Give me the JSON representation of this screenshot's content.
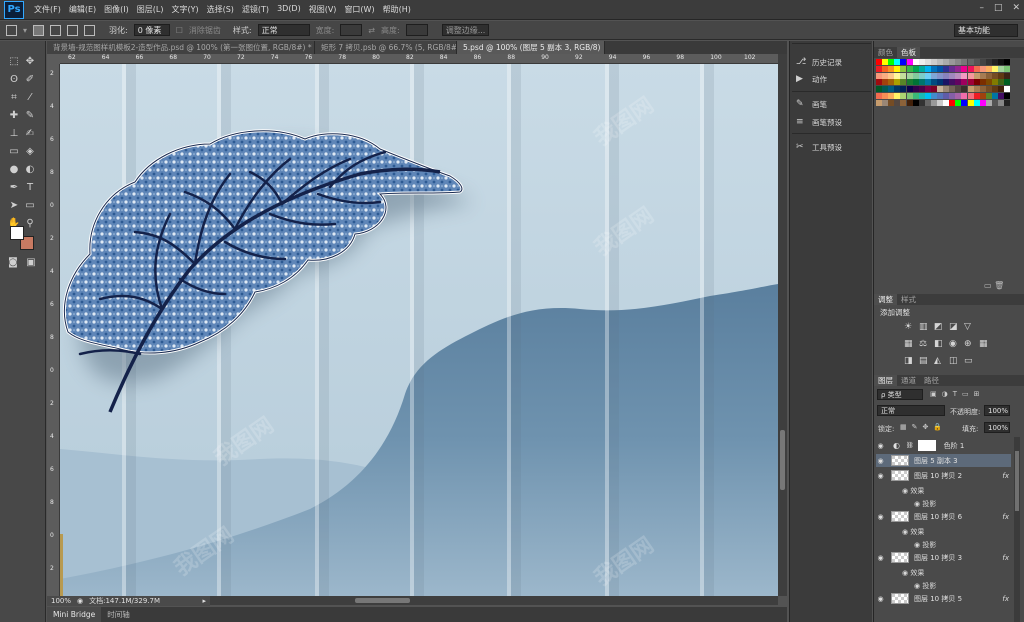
{
  "app": {
    "logo": "Ps"
  },
  "menu": [
    "文件(F)",
    "编辑(E)",
    "图像(I)",
    "图层(L)",
    "文字(Y)",
    "选择(S)",
    "滤镜(T)",
    "3D(D)",
    "视图(V)",
    "窗口(W)",
    "帮助(H)"
  ],
  "window_controls": [
    "–",
    "□",
    "✕"
  ],
  "options": {
    "feather_label": "羽化:",
    "feather_value": "0 像素",
    "antialias_label": "消除锯齿",
    "style_label": "样式:",
    "style_value": "正常",
    "width_label": "宽度:",
    "height_label": "高度:",
    "refine_button": "调整边缘...",
    "workspace": "基本功能"
  },
  "doc_tabs": [
    "背景墙-规范图样机模板2-造型作品.psd @ 100% (第一张图位置, RGB/8#) *",
    "矩形 7 拷贝.psb @ 66.7% (5, RGB/8#)",
    "5.psd @ 100% (图层 5 副本 3, RGB/8)"
  ],
  "ruler": {
    "top": [
      "62",
      "64",
      "66",
      "68",
      "70",
      "72",
      "74",
      "76",
      "78",
      "80",
      "82",
      "84",
      "86",
      "88",
      "90",
      "92",
      "94",
      "96",
      "98",
      "100",
      "102"
    ],
    "left": [
      "2",
      "4",
      "6",
      "8",
      "0",
      "2",
      "4",
      "6",
      "8",
      "0",
      "2",
      "4",
      "6",
      "8",
      "0",
      "2"
    ]
  },
  "status": {
    "zoom": "100%",
    "doc": "文档:147.1M/329.7M"
  },
  "bottom_tabs": [
    "Mini Bridge",
    "时间轴"
  ],
  "middle_panel": [
    "历史记录",
    "动作",
    "画笔",
    "画笔预设",
    "工具预设"
  ],
  "swatch_panel": {
    "tabs": [
      "颜色",
      "色板"
    ]
  },
  "adjust_panel": {
    "tabs": [
      "调整",
      "样式"
    ],
    "title": "添加调整"
  },
  "layers_panel": {
    "tabs": [
      "图层",
      "通道",
      "路径"
    ],
    "filter": "ρ 类型",
    "blend_mode": "正常",
    "opacity_label": "不透明度:",
    "opacity_value": "100%",
    "lock_label": "锁定:",
    "fill_label": "填充:",
    "fill_value": "100%",
    "layers": [
      {
        "name": "色阶 1",
        "kind": "adjust"
      },
      {
        "name": "图层 5 副本 3",
        "kind": "pixel",
        "selected": true
      },
      {
        "name": "图层 10 拷贝 2",
        "kind": "pixel",
        "fx": "fx"
      },
      {
        "name": "效果",
        "kind": "sub"
      },
      {
        "name": "投影",
        "kind": "sub2"
      },
      {
        "name": "图层 10 拷贝 6",
        "kind": "pixel",
        "fx": "fx"
      },
      {
        "name": "效果",
        "kind": "sub"
      },
      {
        "name": "投影",
        "kind": "sub2"
      },
      {
        "name": "图层 10 拷贝 3",
        "kind": "pixel",
        "fx": "fx"
      },
      {
        "name": "效果",
        "kind": "sub"
      },
      {
        "name": "投影",
        "kind": "sub2"
      },
      {
        "name": "图层 10 拷贝 5",
        "kind": "pixel",
        "fx": "fx"
      }
    ]
  },
  "watermark": "我图网",
  "colors": {
    "accent": "#31a8ff",
    "foreground": "#ffffff",
    "background": "#c87a62"
  }
}
